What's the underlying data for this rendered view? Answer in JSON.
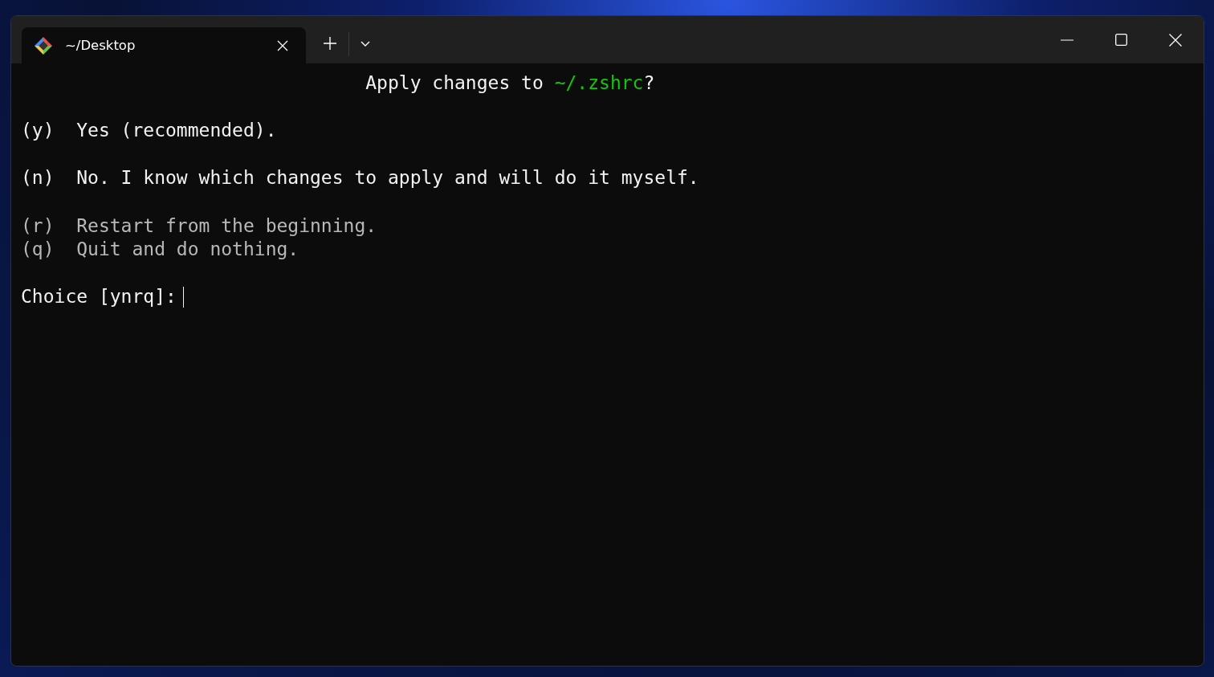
{
  "tab": {
    "title": "~/Desktop",
    "selected": true
  },
  "terminal": {
    "heading": {
      "prefix": "Apply changes to ",
      "path": "~/.zshrc",
      "suffix": "?"
    },
    "options": [
      {
        "key": "(y)",
        "text": "Yes (recommended).",
        "dimmed": false,
        "gap_after": true
      },
      {
        "key": "(n)",
        "text": "No. I know which changes to apply and will do it myself.",
        "dimmed": false,
        "gap_after": true
      },
      {
        "key": "(r)",
        "text": "Restart from the beginning.",
        "dimmed": true,
        "gap_after": false
      },
      {
        "key": "(q)",
        "text": "Quit and do nothing.",
        "dimmed": true,
        "gap_after": true
      }
    ],
    "prompt": "Choice [ynrq]:"
  }
}
